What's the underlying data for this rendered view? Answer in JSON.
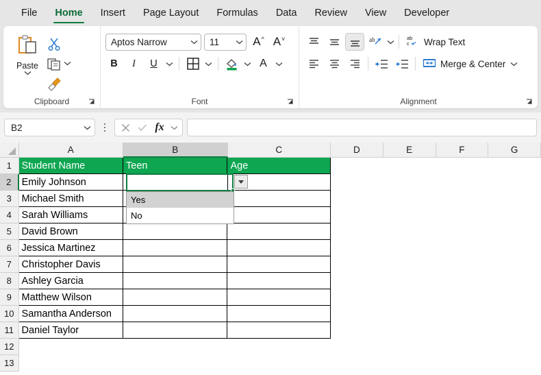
{
  "ribbon": {
    "tabs": [
      {
        "label": "File",
        "active": false
      },
      {
        "label": "Home",
        "active": true
      },
      {
        "label": "Insert",
        "active": false
      },
      {
        "label": "Page Layout",
        "active": false
      },
      {
        "label": "Formulas",
        "active": false
      },
      {
        "label": "Data",
        "active": false
      },
      {
        "label": "Review",
        "active": false
      },
      {
        "label": "View",
        "active": false
      },
      {
        "label": "Developer",
        "active": false
      }
    ],
    "groups": {
      "clipboard": {
        "label": "Clipboard",
        "paste_label": "Paste",
        "cut_name": "cut-icon",
        "copy_name": "copy-icon",
        "format_painter_name": "format-painter-icon"
      },
      "font": {
        "label": "Font",
        "font_name": "Aptos Narrow",
        "font_size": "11",
        "bold": "B",
        "italic": "I",
        "underline": "U"
      },
      "alignment": {
        "label": "Alignment",
        "wrap_text": "Wrap Text",
        "merge_center": "Merge & Center"
      }
    }
  },
  "formula_bar": {
    "name_box": "B2",
    "formula_value": "",
    "cancel_icon": "cancel-icon",
    "enter_icon": "enter-icon",
    "fx_label": "fx"
  },
  "grid": {
    "columns": [
      "A",
      "B",
      "C",
      "D",
      "E",
      "F",
      "G"
    ],
    "selected_column": "B",
    "selected_row": 2,
    "row_numbers": [
      1,
      2,
      3,
      4,
      5,
      6,
      7,
      8,
      9,
      10,
      11,
      12,
      13
    ],
    "header_row": [
      "Student Name",
      "Teen",
      "Age"
    ],
    "header_fill": "#0fa651",
    "selection_color": "#107c41",
    "rows": [
      {
        "num": 1,
        "cells": [
          "Student Name",
          "Teen",
          "Age"
        ],
        "header": true
      },
      {
        "num": 2,
        "cells": [
          "Emily Johnson",
          "",
          ""
        ],
        "header": false
      },
      {
        "num": 3,
        "cells": [
          "Michael Smith",
          "",
          ""
        ],
        "header": false
      },
      {
        "num": 4,
        "cells": [
          "Sarah Williams",
          "",
          ""
        ],
        "header": false
      },
      {
        "num": 5,
        "cells": [
          "David Brown",
          "",
          ""
        ],
        "header": false
      },
      {
        "num": 6,
        "cells": [
          "Jessica Martinez",
          "",
          ""
        ],
        "header": false
      },
      {
        "num": 7,
        "cells": [
          "Christopher Davis",
          "",
          ""
        ],
        "header": false
      },
      {
        "num": 8,
        "cells": [
          "Ashley Garcia",
          "",
          ""
        ],
        "header": false
      },
      {
        "num": 9,
        "cells": [
          "Matthew Wilson",
          "",
          ""
        ],
        "header": false
      },
      {
        "num": 10,
        "cells": [
          "Samantha Anderson",
          "",
          ""
        ],
        "header": false
      },
      {
        "num": 11,
        "cells": [
          "Daniel Taylor",
          "",
          ""
        ],
        "header": false
      },
      {
        "num": 12,
        "cells": [
          "",
          "",
          ""
        ],
        "header": false
      },
      {
        "num": 13,
        "cells": [
          "",
          "",
          ""
        ],
        "header": false
      }
    ],
    "dropdown": {
      "open": true,
      "anchor_cell": "B2",
      "items": [
        {
          "label": "Yes",
          "highlighted": true
        },
        {
          "label": "No",
          "highlighted": false
        }
      ]
    }
  }
}
